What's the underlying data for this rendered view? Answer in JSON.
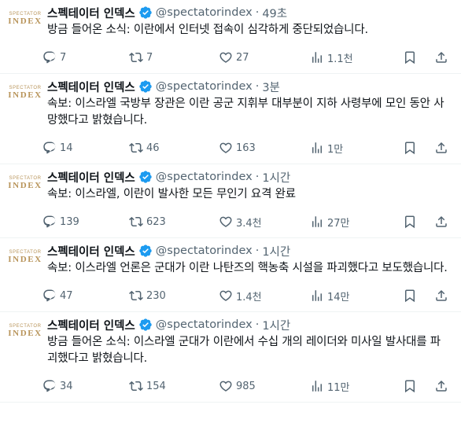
{
  "tweets": [
    {
      "name": "스펙테이터 인덱스",
      "handle": "@spectatorindex",
      "time": "49초",
      "text": "방금 들어온 소식: 이란에서 인터넷 접속이 심각하게 중단되었습니다.",
      "replies": "7",
      "retweets": "7",
      "likes": "27",
      "views": "1.1천"
    },
    {
      "name": "스펙테이터 인덱스",
      "handle": "@spectatorindex",
      "time": "3분",
      "text": "속보: 이스라엘 국방부 장관은 이란 공군 지휘부 대부분이 지하 사령부에 모인 동안 사망했다고 밝혔습니다.",
      "replies": "14",
      "retweets": "46",
      "likes": "163",
      "views": "1만"
    },
    {
      "name": "스펙테이터 인덱스",
      "handle": "@spectatorindex",
      "time": "1시간",
      "text": "속보: 이스라엘, 이란이 발사한 모든 무인기 요격 완료",
      "replies": "139",
      "retweets": "623",
      "likes": "3.4천",
      "views": "27만"
    },
    {
      "name": "스펙테이터 인덱스",
      "handle": "@spectatorindex",
      "time": "1시간",
      "text": "속보: 이스라엘 언론은 군대가 이란 나탄즈의 핵농축 시설을 파괴했다고 보도했습니다.",
      "replies": "47",
      "retweets": "230",
      "likes": "1.4천",
      "views": "14만"
    },
    {
      "name": "스펙테이터 인덱스",
      "handle": "@spectatorindex",
      "time": "1시간",
      "text": "방금 들어온 소식: 이스라엘 군대가 이란에서 수십 개의 레이더와 미사일 발사대를 파괴했다고 밝혔습니다.",
      "replies": "34",
      "retweets": "154",
      "likes": "985",
      "views": "11만"
    }
  ],
  "avatar": {
    "line1": "SPECTATOR",
    "line2": "INDEX"
  },
  "icons": [
    "reply-icon",
    "retweet-icon",
    "like-icon",
    "views-icon",
    "bookmark-icon",
    "share-icon"
  ],
  "colors": {
    "text": "#0f1419",
    "muted": "#536471",
    "verified": "#1d9bf0",
    "avatar_gold": "#b8945a",
    "divider": "#eff3f4"
  }
}
